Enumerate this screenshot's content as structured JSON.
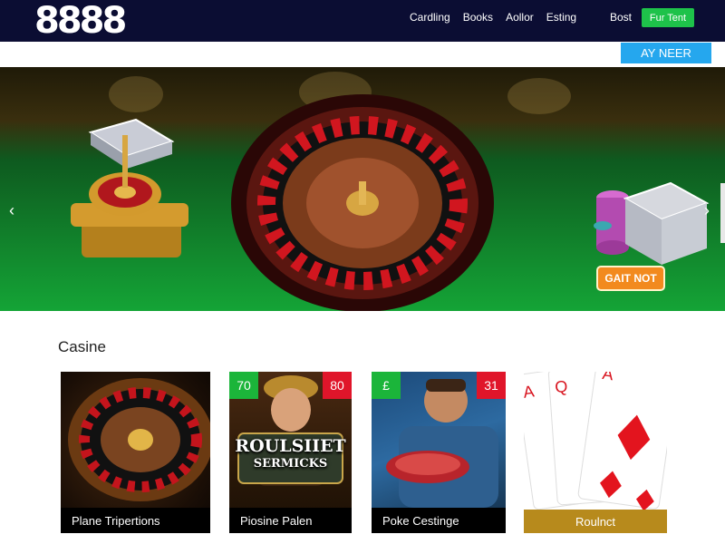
{
  "header": {
    "logo": "8888",
    "nav": [
      "Cardling",
      "Books",
      "Aollor",
      "Esting"
    ],
    "best": "Bost",
    "cta": "Fur Tent"
  },
  "subbar": {
    "cta": "AY NEER"
  },
  "hero": {
    "cta": "GAIT NOT",
    "prev_arrow": "‹",
    "next_arrow": "›"
  },
  "section": {
    "title": "Casine",
    "cards": [
      {
        "label": "Plane Tripertions"
      },
      {
        "label": "Piosine Palen",
        "badge_left": "70",
        "badge_right": "80",
        "heading": "ROULSIIET",
        "subheading": "SERMICKS"
      },
      {
        "label": "Poke Cestinge",
        "badge_left": "£",
        "badge_right": "31"
      },
      {
        "label": "Roulnct"
      }
    ]
  },
  "colors": {
    "header_bg": "#0b0d33",
    "green_cta": "#1ec24a",
    "blue_cta": "#25a7ee",
    "orange_cta": "#f28a1e",
    "felt_green": "#14a436",
    "card_label_gold": "#b78a1c"
  }
}
